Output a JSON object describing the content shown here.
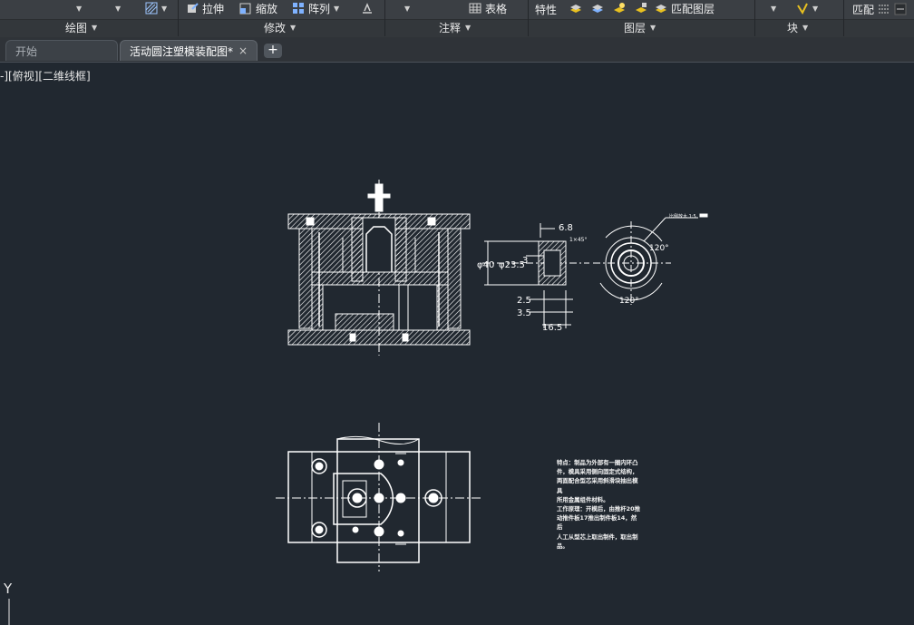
{
  "ribbon": {
    "tools": {
      "stretch": "拉伸",
      "scale": "缩放",
      "array": "阵列",
      "table": "表格",
      "properties": "特性",
      "match_layer": "匹配图层",
      "match": "匹配"
    },
    "groups": {
      "draw": "绘图",
      "modify": "修改",
      "annotation": "注释",
      "layers": "图层",
      "block": "块"
    }
  },
  "tabs": {
    "start": "开始",
    "active": "活动圆注塑模装配图*",
    "close": "×",
    "new": "+"
  },
  "viewport": {
    "label": "-][俯视][二维线框]"
  },
  "drawing": {
    "dims": {
      "d1": "6.8",
      "d2": "1×45°",
      "d3": "φ40",
      "d4": "φ23.5",
      "d5": "3",
      "d6": "2.5",
      "d7": "3.5",
      "d8": "16.5",
      "a1": "120°",
      "a2": "120°",
      "tiny_note": "比例放大 1:5"
    },
    "note_lines": [
      "特点：制品为外部有一圈内环凸",
      "件，模具采用侧向固定式结构，",
      "两面配合型芯采用斜滑块抽出模具",
      "所用金属组件材料。",
      "工作原理：开模后，由推杆20推",
      "动推件板17推出制件板14，然后",
      "人工从型芯上取出制件，取出制",
      "品。"
    ],
    "ucs_axis": "Y"
  },
  "colors": {
    "background": "#212830",
    "ribbon": "#3b3f44",
    "lines": "#ffffff"
  }
}
